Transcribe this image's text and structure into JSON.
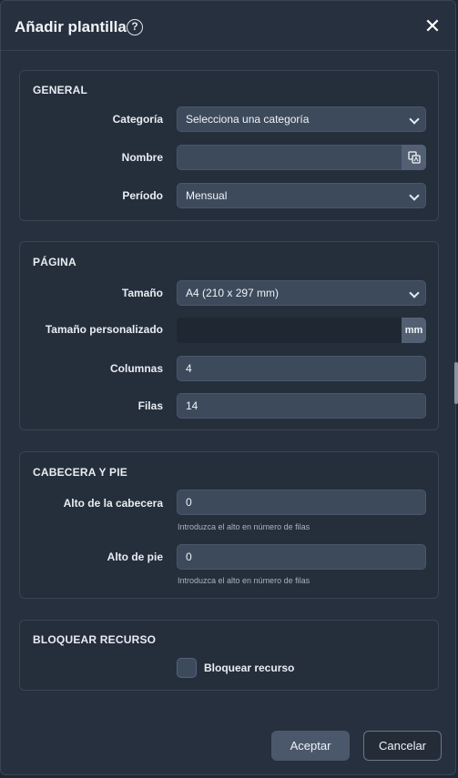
{
  "dialog": {
    "title": "Añadir plantilla",
    "help_glyph": "?",
    "close_glyph": "✕"
  },
  "general": {
    "title": "GENERAL",
    "category_label": "Categoría",
    "category_value": "Selecciona una categoría",
    "name_label": "Nombre",
    "name_value": "",
    "period_label": "Período",
    "period_value": "Mensual"
  },
  "page": {
    "title": "PÁGINA",
    "size_label": "Tamaño",
    "size_value": "A4 (210 x 297 mm)",
    "custom_size_label": "Tamaño personalizado",
    "custom_size_value": "",
    "custom_size_unit": "mm",
    "columns_label": "Columnas",
    "columns_value": "4",
    "rows_label": "Filas",
    "rows_value": "14"
  },
  "header_footer": {
    "title": "CABECERA Y PIE",
    "header_height_label": "Alto de la cabecera",
    "header_height_value": "0",
    "header_hint": "Introduzca el alto en número de filas",
    "footer_height_label": "Alto de pie",
    "footer_height_value": "0",
    "footer_hint": "Introduzca el alto en número de filas"
  },
  "lock": {
    "title": "BLOQUEAR RECURSO",
    "checkbox_label": "Bloquear recurso",
    "checked": false
  },
  "buttons": {
    "accept": "Aceptar",
    "cancel": "Cancelar"
  },
  "icons": {
    "help": "help-circle-icon",
    "close": "close-icon",
    "translate": "translate-icon",
    "dropdown": "chevron-down-icon"
  }
}
